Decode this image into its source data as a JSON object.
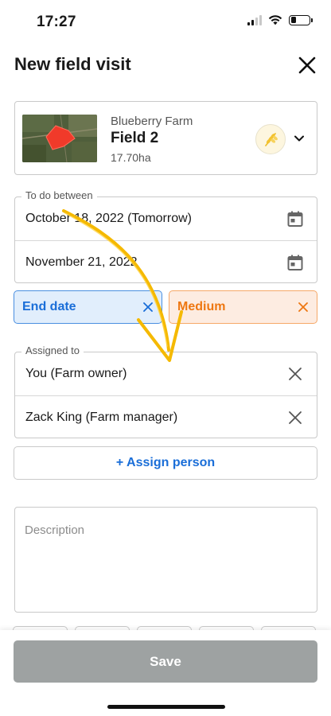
{
  "status_bar": {
    "time": "17:27"
  },
  "header": {
    "title": "New field visit",
    "close_icon": "close-icon"
  },
  "field": {
    "farm_name": "Blueberry Farm",
    "field_name": "Field 2",
    "area": "17.70ha",
    "crop_icon": "wheat-icon"
  },
  "dates": {
    "label": "To do between",
    "start": "October 18, 2022 (Tomorrow)",
    "end": "November 21, 2022"
  },
  "chips": {
    "end_date": "End date",
    "priority": "Medium"
  },
  "assigned": {
    "label": "Assigned to",
    "people": [
      {
        "name": "You (Farm owner)"
      },
      {
        "name": "Zack King (Farm manager)"
      }
    ],
    "add_label": "+ Assign person"
  },
  "description": {
    "placeholder": "Description"
  },
  "footer": {
    "save_label": "Save"
  },
  "colors": {
    "accent_blue": "#1a6ed8",
    "priority_orange": "#ee7711",
    "field_red": "#f03a2a",
    "tutorial_arrow": "#f5b900",
    "save_disabled": "#9ea2a2"
  }
}
